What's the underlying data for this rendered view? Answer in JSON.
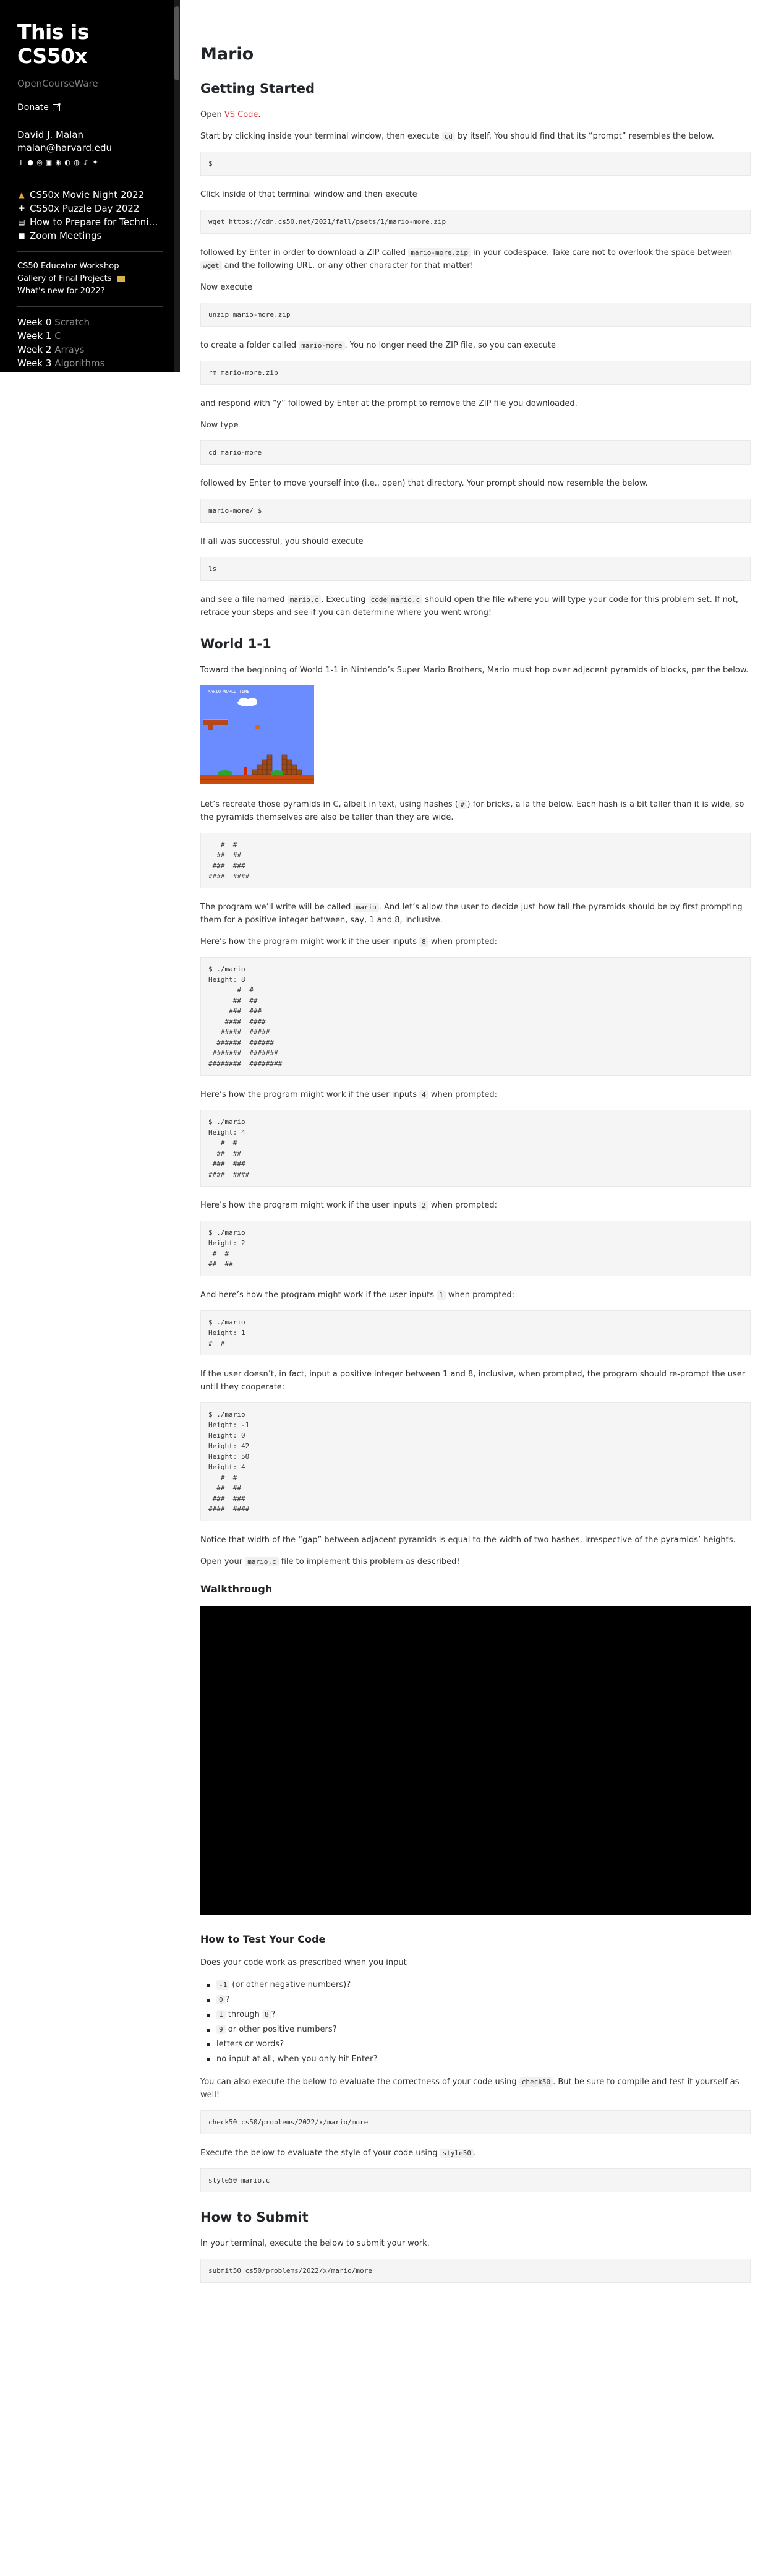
{
  "sidebar": {
    "brand": "This is CS50x",
    "ocw": "OpenCourseWare",
    "donate": "Donate",
    "person_name": "David J. Malan",
    "person_email": "malan@harvard.edu",
    "social_icons": [
      "facebook-icon",
      "github-icon",
      "instagram-icon",
      "linkedin-icon",
      "orcid-icon",
      "quora-icon",
      "reddit-icon",
      "tiktok-icon",
      "twitter-icon"
    ],
    "links": [
      {
        "icon": "popcorn-icon",
        "glyph": "🍿",
        "label": "CS50x Movie Night 2022"
      },
      {
        "icon": "puzzle-icon",
        "glyph": "🧩",
        "label": "CS50x Puzzle Day 2022"
      },
      {
        "icon": "book-icon",
        "glyph": "📘",
        "label": "How to Prepare for Techni…"
      },
      {
        "icon": "video-icon",
        "glyph": "📹",
        "label": "Zoom Meetings"
      }
    ],
    "small_links": [
      "CS50 Educator Workshop",
      "Gallery of Final Projects",
      "What's new for 2022?"
    ],
    "weeks": [
      {
        "label": "Week 0",
        "topic": "Scratch"
      },
      {
        "label": "Week 1",
        "topic": "C"
      },
      {
        "label": "Week 2",
        "topic": "Arrays"
      },
      {
        "label": "Week 3",
        "topic": "Algorithms"
      }
    ]
  },
  "main": {
    "title": "Mario",
    "getting_started": {
      "heading": "Getting Started",
      "p1_a": "Open ",
      "p1_link": "VS Code",
      "p1_b": ".",
      "p2_a": "Start by clicking inside your terminal window, then execute ",
      "p2_code": "cd",
      "p2_b": " by itself. You should find that its “prompt” resembles the below.",
      "code1": "$",
      "p3": "Click inside of that terminal window and then execute",
      "code2": "wget https://cdn.cs50.net/2021/fall/psets/1/mario-more.zip",
      "p4_a": "followed by Enter in order to download a ZIP called ",
      "p4_code1": "mario-more.zip",
      "p4_b": " in your codespace. Take care not to overlook the space between ",
      "p4_code2": "wget",
      "p4_c": " and the following URL, or any other character for that matter!",
      "p5": "Now execute",
      "code3": "unzip mario-more.zip",
      "p6_a": "to create a folder called ",
      "p6_code": "mario-more",
      "p6_b": ". You no longer need the ZIP file, so you can execute",
      "code4": "rm mario-more.zip",
      "p7": "and respond with “y” followed by Enter at the prompt to remove the ZIP file you downloaded.",
      "p8": "Now type",
      "code5": "cd mario-more",
      "p9": "followed by Enter to move yourself into (i.e., open) that directory. Your prompt should now resemble the below.",
      "code6": "mario-more/ $",
      "p10": "If all was successful, you should execute",
      "code7": "ls",
      "p11_a": "and see a file named ",
      "p11_code1": "mario.c",
      "p11_b": ". Executing ",
      "p11_code2": "code mario.c",
      "p11_c": " should open the file where you will type your code for this problem set. If not, retrace your steps and see if you can determine where you went wrong!"
    },
    "world": {
      "heading": "World 1-1",
      "p1": "Toward the beginning of World 1-1 in Nintendo’s Super Mario Brothers, Mario must hop over adjacent pyramids of blocks, per the below.",
      "hud": "MARIO  WORLD  TIME",
      "p2_a": "Let’s recreate those pyramids in C, albeit in text, using hashes (",
      "p2_code": "#",
      "p2_b": ") for bricks, a la the below. Each hash is a bit taller than it is wide, so the pyramids themselves are also be taller than they are wide.",
      "pyr": "   #  #\n  ##  ##\n ###  ###\n####  ####",
      "p3_a": "The program we’ll write will be called ",
      "p3_code": "mario",
      "p3_b": ". And let’s allow the user to decide just how tall the pyramids should be by first prompting them for a positive integer between, say, 1 and 8, inclusive.",
      "p4_a": "Here’s how the program might work if the user inputs ",
      "p4_code": "8",
      "p4_b": " when prompted:",
      "ex8": "$ ./mario\nHeight: 8\n       #  #\n      ##  ##\n     ###  ###\n    ####  ####\n   #####  #####\n  ######  ######\n #######  #######\n########  ########",
      "p5_a": "Here’s how the program might work if the user inputs ",
      "p5_code": "4",
      "p5_b": " when prompted:",
      "ex4": "$ ./mario\nHeight: 4\n   #  #\n  ##  ##\n ###  ###\n####  ####",
      "p6_a": "Here’s how the program might work if the user inputs ",
      "p6_code": "2",
      "p6_b": " when prompted:",
      "ex2": "$ ./mario\nHeight: 2\n #  #\n##  ##",
      "p7_a": "And here’s how the program might work if the user inputs ",
      "p7_code": "1",
      "p7_b": " when prompted:",
      "ex1": "$ ./mario\nHeight: 1\n#  #",
      "p8": "If the user doesn’t, in fact, input a positive integer between 1 and 8, inclusive, when prompted, the program should re-prompt the user until they cooperate:",
      "exbad": "$ ./mario\nHeight: -1\nHeight: 0\nHeight: 42\nHeight: 50\nHeight: 4\n   #  #\n  ##  ##\n ###  ###\n####  ####",
      "p9": "Notice that width of the “gap” between adjacent pyramids is equal to the width of two hashes, irrespective of the pyramids’ heights.",
      "p10_a": "Open your ",
      "p10_code": "mario.c",
      "p10_b": " file to implement this problem as described!"
    },
    "walkthrough": {
      "heading": "Walkthrough"
    },
    "testing": {
      "heading": "How to Test Your Code",
      "p1": "Does your code work as prescribed when you input",
      "items": [
        {
          "code": "-1",
          "text": " (or other negative numbers)?"
        },
        {
          "code": "0",
          "text": "?"
        },
        {
          "code": "1",
          "text": " through ",
          "code2": "8",
          "text2": "?"
        },
        {
          "code": "9",
          "text": " or other positive numbers?"
        },
        {
          "code": "",
          "text": "letters or words?"
        },
        {
          "code": "",
          "text": "no input at all, when you only hit Enter?"
        }
      ],
      "p2_a": "You can also execute the below to evaluate the correctness of your code using ",
      "p2_code": "check50",
      "p2_b": ". But be sure to compile and test it yourself as well!",
      "code1": "check50 cs50/problems/2022/x/mario/more",
      "p3_a": "Execute the below to evaluate the style of your code using ",
      "p3_code": "style50",
      "p3_b": ".",
      "code2": "style50 mario.c"
    },
    "submit": {
      "heading": "How to Submit",
      "p1": "In your terminal, execute the below to submit your work.",
      "code1": "submit50 cs50/problems/2022/x/mario/more"
    }
  }
}
